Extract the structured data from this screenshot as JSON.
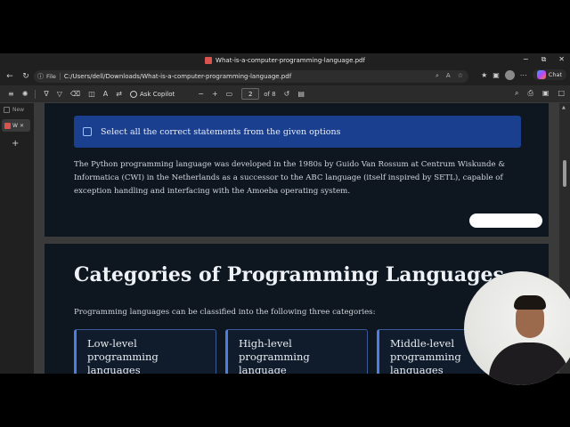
{
  "browser": {
    "title": "What-is-a-computer-programming-language.pdf",
    "window_controls": [
      "−",
      "⧉",
      "✕"
    ],
    "address": {
      "scheme_label": "File",
      "url": "C:/Users/dell/Downloads/What-is-a-computer-programming-language.pdf"
    },
    "copilot_label": "Chat",
    "sidebar": {
      "new_tab_label": "New",
      "active_tab_label": "W",
      "add_tab": "+"
    }
  },
  "pdf_toolbar": {
    "ask_copilot_label": "Ask Copilot",
    "zoom_out": "−",
    "zoom_in": "+",
    "current_page": "2",
    "page_count_label": "of 8"
  },
  "document": {
    "callout_text": "Select all the correct statements from the given options",
    "paragraph": "The Python programming language was developed in the 1980s by Guido Van Rossum at Centrum Wiskunde & Informatica (CWI) in the Netherlands as a successor to the ABC language (itself inspired by SETL), capable of exception handling and interfacing with the Amoeba operating system.",
    "section_heading": "Categories of Programming Languages",
    "section_intro": "Programming languages can be classified into the following three categories:",
    "cards": [
      {
        "line1": "Low-level",
        "line2": "programming",
        "line3": "languages"
      },
      {
        "line1": "High-level",
        "line2": "programming language",
        "line3": ""
      },
      {
        "line1": "Middle-level",
        "line2": "programming",
        "line3": "languages"
      }
    ]
  },
  "colors": {
    "callout_bg": "#1a3f8f",
    "page_bg": "#0e1620",
    "card_accent": "#4c7fe0"
  }
}
